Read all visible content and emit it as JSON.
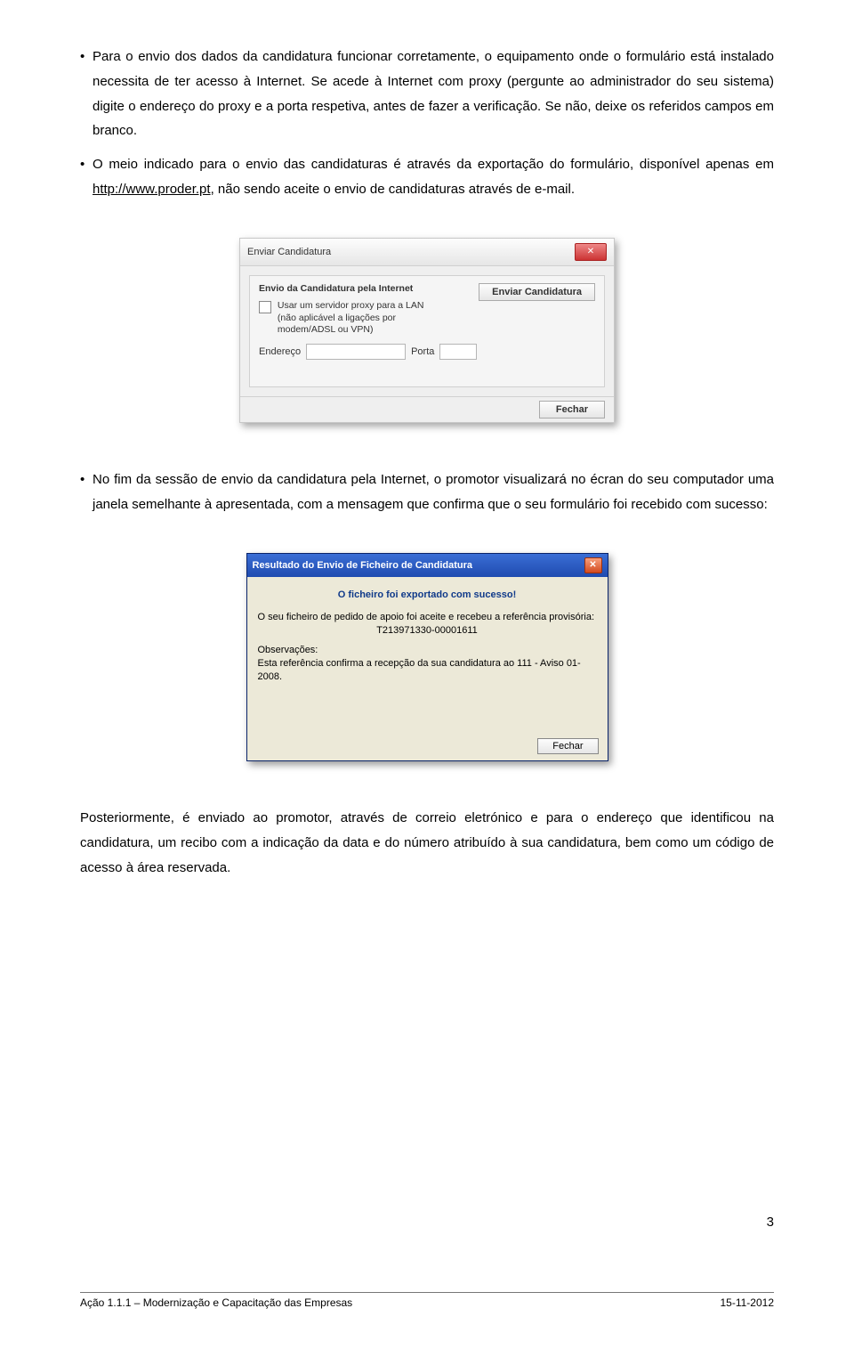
{
  "para1": {
    "bullet": "•",
    "text": "Para o envio dos dados da candidatura funcionar corretamente, o equipamento onde o formulário está instalado necessita de ter acesso à Internet. Se acede à Internet com proxy (pergunte ao administrador do seu sistema) digite o endereço do proxy e a porta respetiva, antes de fazer a verificação. Se não, deixe os referidos campos em branco."
  },
  "para2": {
    "bullet": "•",
    "text_before_link": "O meio indicado para o envio das candidaturas é através da exportação do formulário, disponível apenas em ",
    "link": "http://www.proder.pt",
    "text_after_link": ", não sendo aceite o envio de candidaturas através de e-mail."
  },
  "dialog1": {
    "title": "Enviar Candidatura",
    "frame_title": "Envio da Candidatura pela Internet",
    "send_button": "Enviar Candidatura",
    "proxy_label_l1": "Usar um servidor proxy para a LAN",
    "proxy_label_l2": "(não aplicável a ligações por",
    "proxy_label_l3": "modem/ADSL ou VPN)",
    "endereco_label": "Endereço",
    "porta_label": "Porta",
    "fechar": "Fechar"
  },
  "para3": {
    "bullet": "•",
    "text": "No fim da sessão de envio da candidatura pela Internet, o promotor visualizará no écran do seu computador uma janela semelhante à apresentada, com a mensagem que confirma que o seu formulário foi recebido com sucesso:"
  },
  "dialog2": {
    "title": "Resultado do Envio de Ficheiro de Candidatura",
    "headline": "O ficheiro foi exportado com sucesso!",
    "line1": "O seu ficheiro de pedido de apoio foi aceite e recebeu a referência provisória:",
    "ref": "T213971330-00001611",
    "obs_label": "Observações:",
    "obs_text": "Esta referência confirma a recepção da sua candidatura ao 111 - Aviso 01-2008.",
    "fechar": "Fechar"
  },
  "para4": {
    "text": "Posteriormente, é enviado ao promotor, através de correio eletrónico e para o endereço que identificou na candidatura, um recibo com a indicação da data e do número atribuído à sua candidatura, bem como um código de acesso à área reservada."
  },
  "page_number": "3",
  "footer_left": "Ação 1.1.1 – Modernização e Capacitação das Empresas",
  "footer_right": "15-11-2012"
}
